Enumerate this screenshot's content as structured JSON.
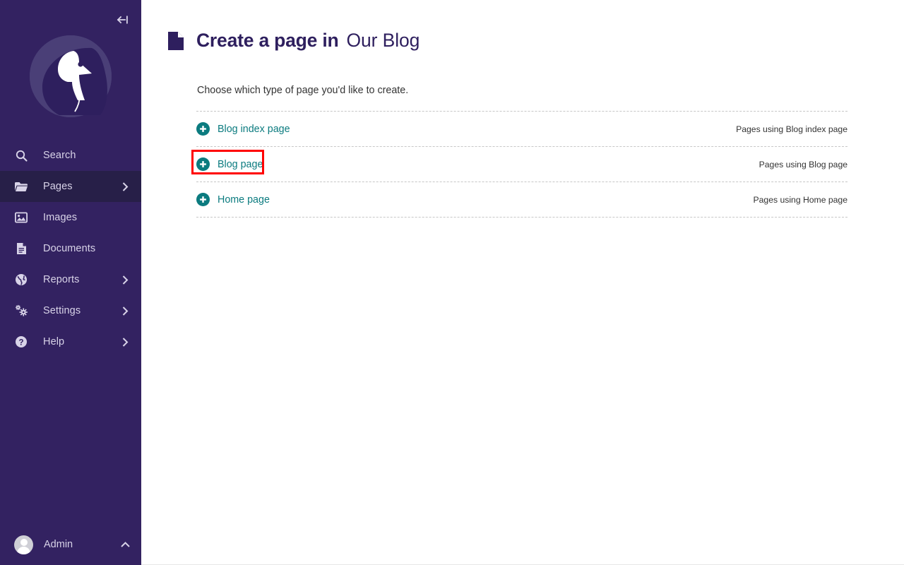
{
  "sidebar": {
    "collapse_icon": "collapse-left-icon",
    "logo": "wagtail-bird-logo",
    "items": [
      {
        "label": "Search",
        "icon": "search-icon",
        "has_chevron": false,
        "active": false
      },
      {
        "label": "Pages",
        "icon": "folder-icon",
        "has_chevron": true,
        "active": true
      },
      {
        "label": "Images",
        "icon": "image-icon",
        "has_chevron": false,
        "active": false
      },
      {
        "label": "Documents",
        "icon": "document-icon",
        "has_chevron": false,
        "active": false
      },
      {
        "label": "Reports",
        "icon": "globe-icon",
        "has_chevron": true,
        "active": false
      },
      {
        "label": "Settings",
        "icon": "gear-icon",
        "has_chevron": true,
        "active": false
      },
      {
        "label": "Help",
        "icon": "help-icon",
        "has_chevron": true,
        "active": false
      }
    ],
    "account": {
      "name": "Admin",
      "avatar": "user-avatar",
      "chevron": "chevron-up-icon"
    }
  },
  "header": {
    "icon": "page-document-icon",
    "title": "Create a page in",
    "parent_page": "Our Blog"
  },
  "main": {
    "intro": "Choose which type of page you'd like to create.",
    "page_types": [
      {
        "label": "Blog index page",
        "usage_label": "Pages using Blog index page",
        "add_icon": "plus-circle-icon",
        "highlighted": false
      },
      {
        "label": "Blog page",
        "usage_label": "Pages using Blog page",
        "add_icon": "plus-circle-icon",
        "highlighted": true
      },
      {
        "label": "Home page",
        "usage_label": "Pages using Home page",
        "add_icon": "plus-circle-icon",
        "highlighted": false
      }
    ]
  },
  "colors": {
    "sidebar_bg": "#332261",
    "sidebar_active_bg": "#271f48",
    "accent_teal": "#0b7b7f",
    "title_purple": "#2e1f5e",
    "highlight_red": "#ff0000"
  }
}
